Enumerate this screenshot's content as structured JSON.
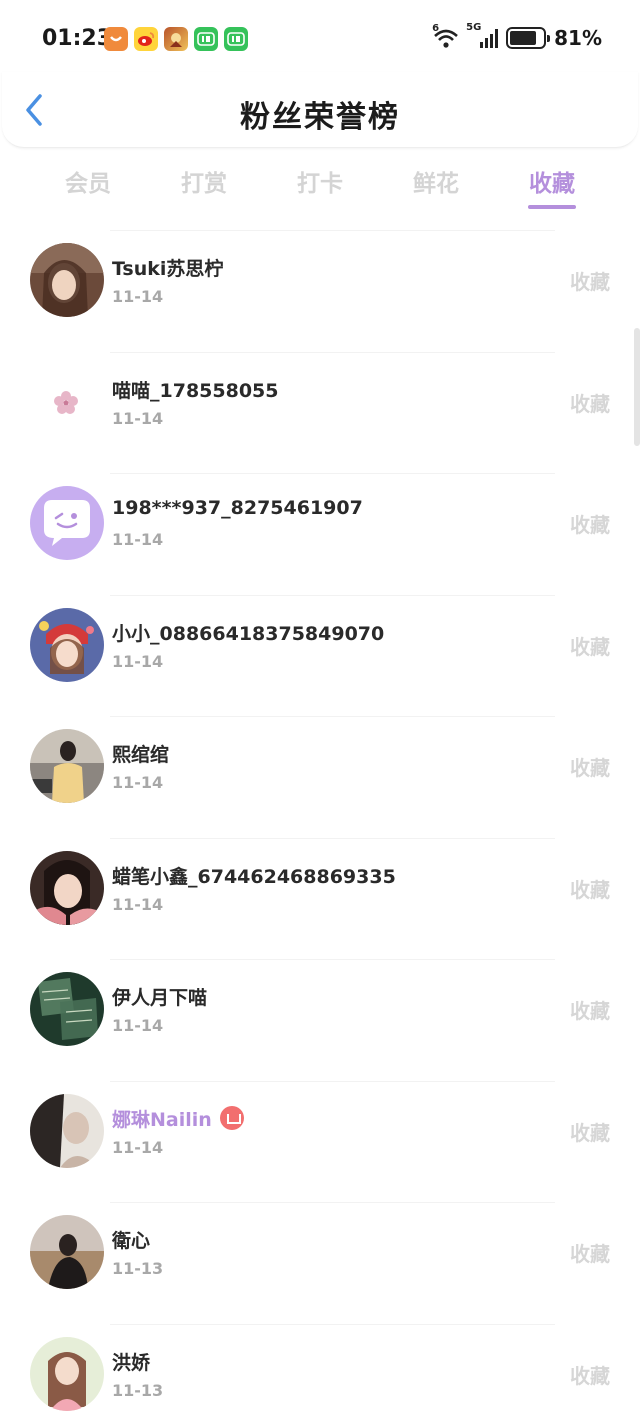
{
  "status_bar": {
    "time": "01:23",
    "notifications": [
      {
        "icon": "taobao-icon"
      },
      {
        "icon": "weibo-icon"
      },
      {
        "icon": "game-icon"
      },
      {
        "icon": "iqiyi-icon"
      },
      {
        "icon": "iqiyi-icon"
      }
    ],
    "wifi_label": "6",
    "network_label": "5G",
    "battery_percent": 81,
    "battery_text": "81%"
  },
  "header": {
    "title": "粉丝荣誉榜"
  },
  "tabs": {
    "items": [
      "会员",
      "打赏",
      "打卡",
      "鲜花",
      "收藏"
    ],
    "active_index": 4
  },
  "colors": {
    "accent": "#b48fdc",
    "inactive_tab": "#d4d4d4",
    "date": "#a8a8a8",
    "action": "#d6d6d6",
    "back_arrow": "#4a90e2",
    "vip_badge": "#f26f6f"
  },
  "list": {
    "action_label": "收藏",
    "items": [
      {
        "name": "Tsuki苏思柠",
        "date": "11-14",
        "avatar": "photo-girl-brown"
      },
      {
        "name": "喵喵_178558055",
        "date": "11-14",
        "avatar": "pink-flower"
      },
      {
        "name": "198***937_8275461907",
        "date": "11-14",
        "avatar": "default-chat-bubble"
      },
      {
        "name": "小小_08866418375849070",
        "date": "11-14",
        "avatar": "doll-photo"
      },
      {
        "name": "熙绾绾",
        "date": "11-14",
        "avatar": "photo-girl-street"
      },
      {
        "name": "蜡笔小鑫_674462468869335",
        "date": "11-14",
        "avatar": "photo-girl-close"
      },
      {
        "name": "伊人月下喵",
        "date": "11-14",
        "avatar": "dark-green-art"
      },
      {
        "name": "娜琳Nailin",
        "date": "11-14",
        "avatar": "photo-girl-dark",
        "vip": true,
        "badge_icon": "diamond-vip-icon"
      },
      {
        "name": "衛心",
        "date": "11-13",
        "avatar": "photo-girl-field"
      },
      {
        "name": "洪娇",
        "date": "11-13",
        "avatar": "photo-girl-pink"
      }
    ]
  }
}
